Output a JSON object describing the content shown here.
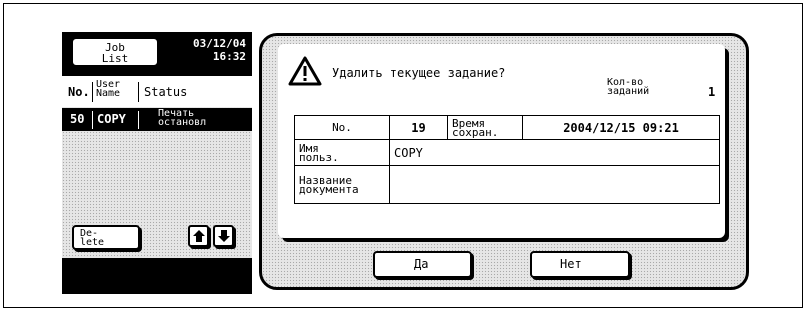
{
  "left_panel": {
    "job_list_button": "Job\nList",
    "date": "03/12/04",
    "time": "16:32",
    "columns": {
      "no": "No.",
      "user": "User\nName",
      "status": "Status"
    },
    "rows": [
      {
        "no": "50",
        "user": "COPY",
        "status": "Печать\nостановл"
      }
    ],
    "delete_button": "De-\nlete"
  },
  "dialog": {
    "message": "Удалить текущее задание?",
    "count_label": "Кол-во\nзаданий",
    "count_value": "1",
    "table": {
      "no_label": "No.",
      "no_value": "19",
      "time_label": "Время\nсохран.",
      "time_value": "2004/12/15 09:21",
      "user_label": "Имя\nпольз.",
      "user_value": "COPY",
      "doc_label": "Название\nдокумента",
      "doc_value": ""
    },
    "yes_button": "Да",
    "no_button": "Нет"
  },
  "icons": [
    "warning-icon",
    "arrow-up-icon",
    "arrow-down-icon"
  ]
}
